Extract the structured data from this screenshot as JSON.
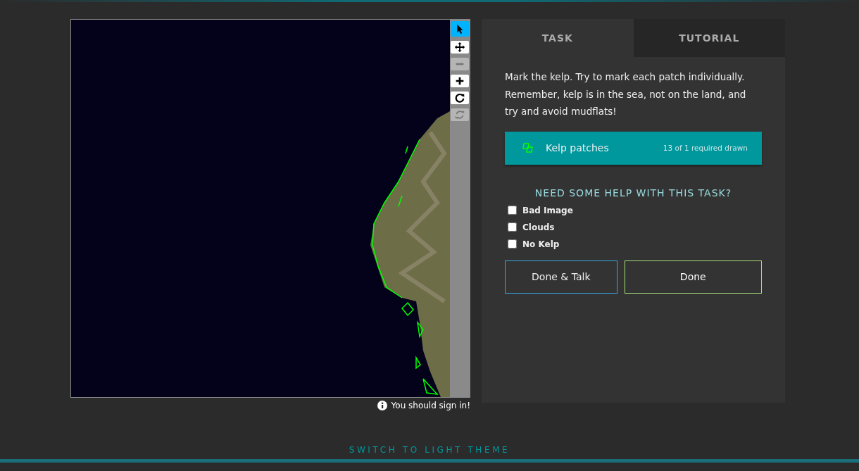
{
  "tools": [
    {
      "kind": "pointer",
      "selected": true,
      "disabled": false
    },
    {
      "kind": "move",
      "selected": false,
      "disabled": false
    },
    {
      "kind": "zoom-out",
      "selected": false,
      "disabled": true
    },
    {
      "kind": "zoom-in",
      "selected": false,
      "disabled": false
    },
    {
      "kind": "rotate",
      "selected": false,
      "disabled": false
    },
    {
      "kind": "reset",
      "selected": false,
      "disabled": true
    }
  ],
  "sign_in_notice": "You should sign in!",
  "tabs": [
    {
      "label": "TASK",
      "selected": true
    },
    {
      "label": "TUTORIAL",
      "selected": false
    }
  ],
  "instructions": "Mark the kelp. Try to mark each patch individually. Remember, kelp is in the sea, not on the land, and try and avoid mudflats!",
  "drawing_tool": {
    "label": "Kelp patches",
    "count": "13 of 1 required drawn",
    "color": "#00ff00",
    "selected": true
  },
  "help": {
    "heading": "NEED SOME HELP WITH THIS TASK?",
    "options": [
      {
        "label": "Bad Image",
        "checked": false
      },
      {
        "label": "Clouds",
        "checked": false
      },
      {
        "label": "No Kelp",
        "checked": false
      }
    ]
  },
  "buttons": [
    {
      "label": "Done & Talk",
      "kind": "talk"
    },
    {
      "label": "Done",
      "kind": "done"
    }
  ],
  "theme_link": "SWITCH TO LIGHT THEME"
}
